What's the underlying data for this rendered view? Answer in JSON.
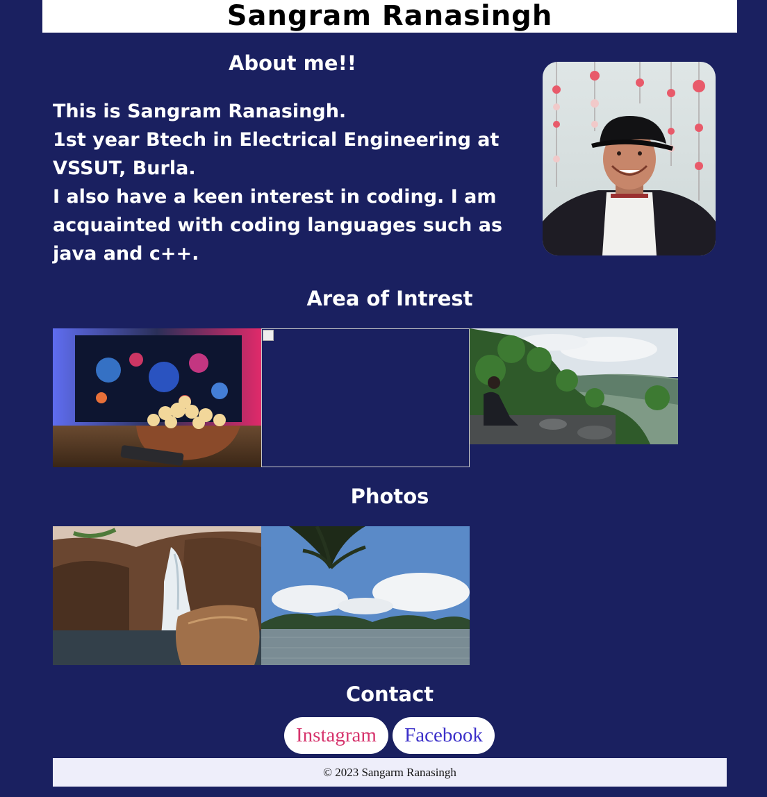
{
  "header": {
    "title": "Sangram Ranasingh"
  },
  "about": {
    "heading": "About me!!",
    "lines": [
      "This is Sangram Ranasingh.",
      "1st year Btech in Electrical Engineering at VSSUT, Burla.",
      "I also have a keen interest in coding. I am acquainted with coding languages such as java and c++."
    ]
  },
  "interest": {
    "heading": "Area of Intrest"
  },
  "photos": {
    "heading": "Photos"
  },
  "contact": {
    "heading": "Contact",
    "links": [
      {
        "label": "Instagram",
        "color": "#d6336c"
      },
      {
        "label": "Facebook",
        "color": "#3b2fc9"
      }
    ]
  },
  "footer": {
    "text": "© 2023 Sangarm Ranasingh"
  },
  "colors": {
    "background": "#1a2060",
    "header_bg": "#ffffff",
    "footer_bg": "#eeeefa"
  }
}
